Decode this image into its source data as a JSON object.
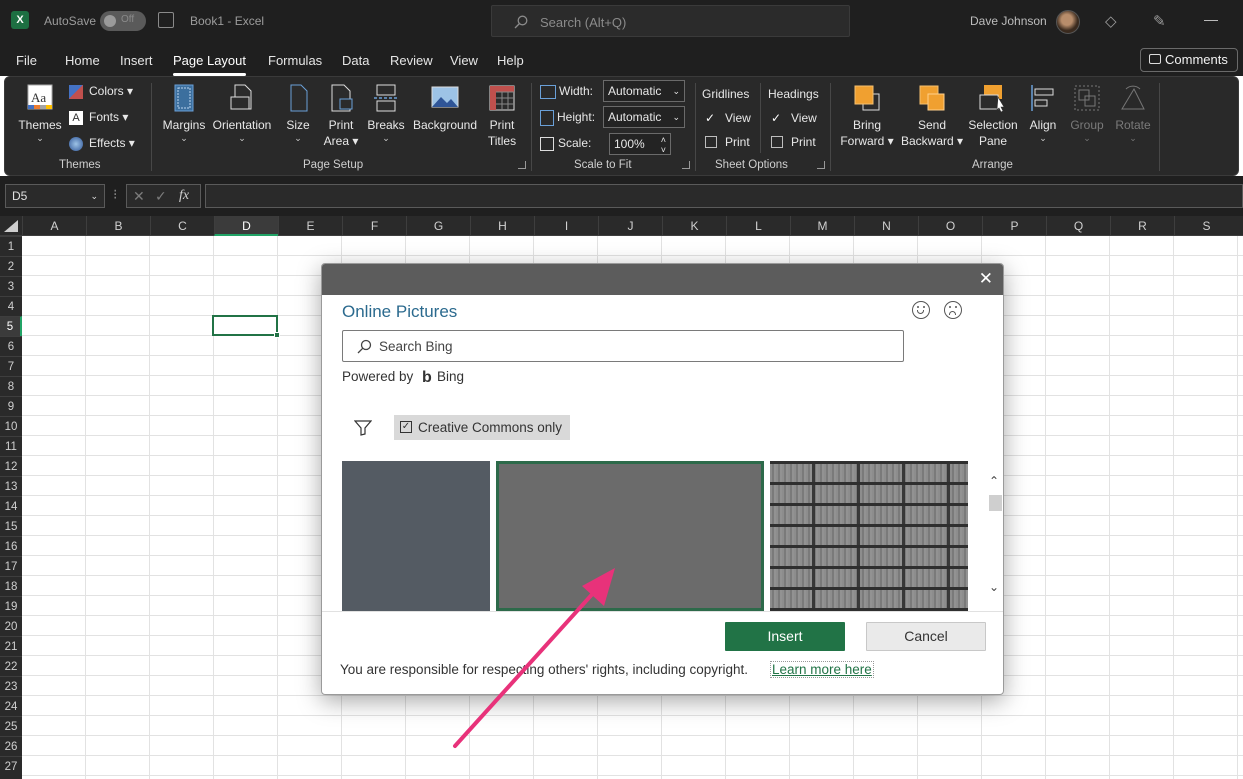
{
  "window": {
    "app_icon": "X",
    "autosave_label": "AutoSave",
    "autosave_state": "Off",
    "doc_title": "Book1  -  Excel",
    "search_placeholder": "Search (Alt+Q)",
    "user_name": "Dave Johnson"
  },
  "menu": {
    "tabs": [
      "File",
      "Home",
      "Insert",
      "Page Layout",
      "Formulas",
      "Data",
      "Review",
      "View",
      "Help"
    ],
    "active_tab": "Page Layout",
    "comments_label": "Comments"
  },
  "ribbon": {
    "themes": {
      "themes_label": "Themes",
      "colors": "Colors",
      "fonts": "Fonts",
      "effects": "Effects",
      "group": "Themes"
    },
    "page_setup": {
      "margins": "Margins",
      "orientation": "Orientation",
      "size": "Size",
      "print_area_1": "Print",
      "print_area_2": "Area",
      "breaks": "Breaks",
      "background": "Background",
      "print_titles_1": "Print",
      "print_titles_2": "Titles",
      "group": "Page Setup"
    },
    "scale_to_fit": {
      "width_label": "Width:",
      "width_value": "Automatic",
      "height_label": "Height:",
      "height_value": "Automatic",
      "scale_label": "Scale:",
      "scale_value": "100%",
      "group": "Scale to Fit"
    },
    "sheet_options": {
      "gridlines": "Gridlines",
      "headings": "Headings",
      "view": "View",
      "print": "Print",
      "group": "Sheet Options"
    },
    "arrange": {
      "bring_forward_1": "Bring",
      "bring_forward_2": "Forward",
      "send_backward_1": "Send",
      "send_backward_2": "Backward",
      "selection_pane_1": "Selection",
      "selection_pane_2": "Pane",
      "align": "Align",
      "group_btn": "Group",
      "rotate": "Rotate",
      "group": "Arrange"
    }
  },
  "formula_bar": {
    "name_box": "D5",
    "fx": "fx"
  },
  "grid": {
    "columns": [
      "A",
      "B",
      "C",
      "D",
      "E",
      "F",
      "G",
      "H",
      "I",
      "J",
      "K",
      "L",
      "M",
      "N",
      "O",
      "P",
      "Q",
      "R",
      "S"
    ],
    "rows": [
      "1",
      "2",
      "3",
      "4",
      "5",
      "6",
      "7",
      "8",
      "9",
      "10",
      "11",
      "12",
      "13",
      "14",
      "15",
      "16",
      "17",
      "18",
      "19",
      "20",
      "21",
      "22",
      "23",
      "24",
      "25",
      "26",
      "27"
    ],
    "selected_column": "D",
    "selected_row": "5"
  },
  "dialog": {
    "title": "Online Pictures",
    "search_placeholder": "Search Bing",
    "powered_by": "Powered by",
    "bing_logo": "b",
    "bing": "Bing",
    "filter_label": "Creative Commons only",
    "insert": "Insert",
    "cancel": "Cancel",
    "note": "You are responsible for respecting others' rights, including copyright.",
    "learn_more": "Learn more here"
  },
  "colors": {
    "excel_green": "#217346",
    "arrow": "#e8327a",
    "dialog_title": "#2b6a8e"
  }
}
